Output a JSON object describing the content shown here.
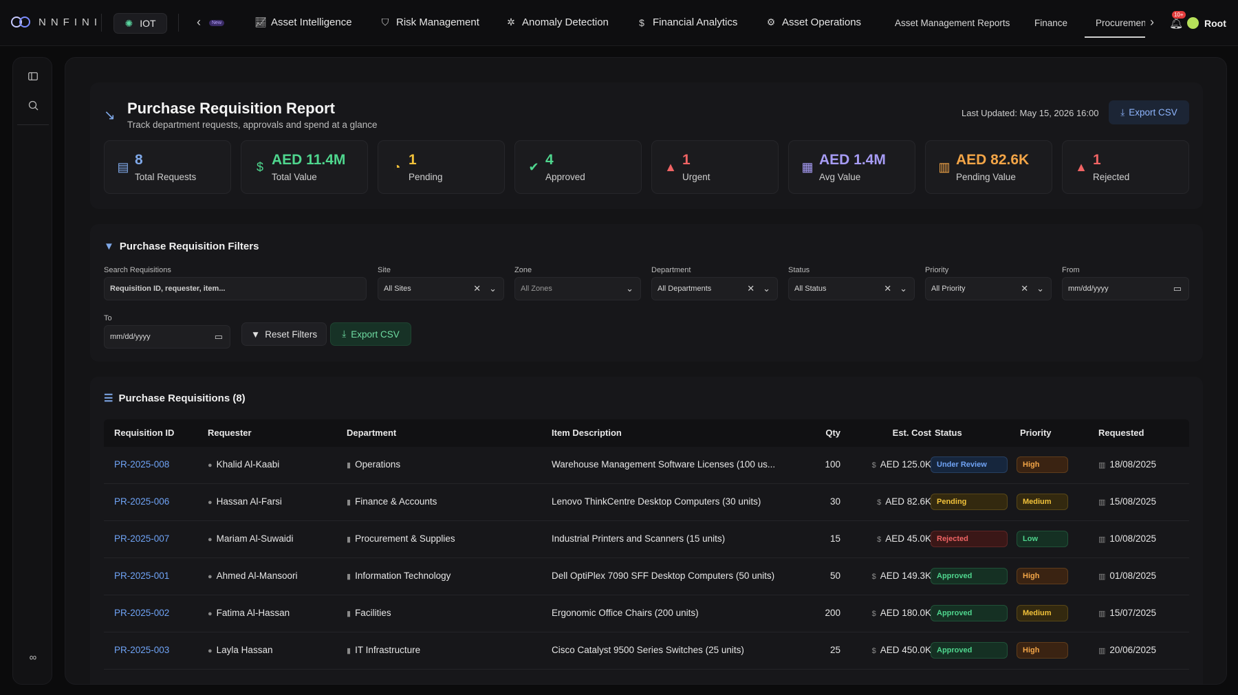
{
  "app": {
    "logo_text": "NNFINI",
    "user": "Root",
    "bell_badge": "10+"
  },
  "topnav": {
    "iot_label": "IOT",
    "new_badge": "New",
    "items": [
      {
        "label": "Asset Intelligence",
        "icon": "chart-line-icon"
      },
      {
        "label": "Risk Management",
        "icon": "shield-icon"
      },
      {
        "label": "Anomaly Detection",
        "icon": "bug-icon"
      },
      {
        "label": "Financial Analytics",
        "icon": "dollar-icon"
      },
      {
        "label": "Asset Operations",
        "icon": "gear-icon"
      }
    ],
    "tabs": [
      "Asset Management Reports",
      "Finance",
      "Procurement"
    ]
  },
  "header": {
    "title": "Purchase Requisition Report",
    "subtitle": "Track department requests, approvals and spend at a glance",
    "last_updated": "Last Updated: May 15, 2026 16:00",
    "export_label": "Export CSV"
  },
  "stats": [
    {
      "value": "8",
      "label": "Total Requests",
      "color": "#7fa8e8",
      "icon": "document-icon"
    },
    {
      "value": "AED 11.4M",
      "label": "Total Value",
      "color": "#4fd68e",
      "icon": "dollar-icon"
    },
    {
      "value": "1",
      "label": "Pending",
      "color": "#f2c23a",
      "icon": "clock-icon"
    },
    {
      "value": "4",
      "label": "Approved",
      "color": "#4fd68e",
      "icon": "check-circle-icon"
    },
    {
      "value": "1",
      "label": "Urgent",
      "color": "#f06464",
      "icon": "warning-icon"
    },
    {
      "value": "AED 1.4M",
      "label": "Avg Value",
      "color": "#a79cf5",
      "icon": "calculator-icon"
    },
    {
      "value": "AED 82.6K",
      "label": "Pending Value",
      "color": "#f3a547",
      "icon": "calendar-icon"
    },
    {
      "value": "1",
      "label": "Rejected",
      "color": "#f06464",
      "icon": "warning-icon"
    }
  ],
  "filters": {
    "title": "Purchase Requisition Filters",
    "search_label": "Search Requisitions",
    "search_placeholder": "Requisition ID, requester, item...",
    "site_label": "Site",
    "site_value": "All Sites",
    "zone_label": "Zone",
    "zone_value": "All Zones",
    "dept_label": "Department",
    "dept_value": "All Departments",
    "status_label": "Status",
    "status_value": "All Status",
    "priority_label": "Priority",
    "priority_value": "All Priority",
    "from_label": "From",
    "from_value": "mm/dd/yyyy",
    "to_label": "To",
    "to_value": "mm/dd/yyyy",
    "reset_label": "Reset Filters",
    "export_label": "Export CSV"
  },
  "table": {
    "title": "Purchase Requisitions (8)",
    "columns": [
      "Requisition ID",
      "Requester",
      "Department",
      "Item Description",
      "Qty",
      "Est. Cost",
      "Status",
      "Priority",
      "Requested"
    ],
    "rows": [
      {
        "id": "PR-2025-008",
        "requester": "Khalid Al-Kaabi",
        "dept": "Operations",
        "item": "Warehouse Management Software Licenses (100 us...",
        "qty": "100",
        "cost": "AED 125.0K",
        "status": "Under Review",
        "priority": "High",
        "date": "18/08/2025"
      },
      {
        "id": "PR-2025-006",
        "requester": "Hassan Al-Farsi",
        "dept": "Finance & Accounts",
        "item": "Lenovo ThinkCentre Desktop Computers (30 units)",
        "qty": "30",
        "cost": "AED 82.6K",
        "status": "Pending",
        "priority": "Medium",
        "date": "15/08/2025"
      },
      {
        "id": "PR-2025-007",
        "requester": "Mariam Al-Suwaidi",
        "dept": "Procurement & Supplies",
        "item": "Industrial Printers and Scanners (15 units)",
        "qty": "15",
        "cost": "AED 45.0K",
        "status": "Rejected",
        "priority": "Low",
        "date": "10/08/2025"
      },
      {
        "id": "PR-2025-001",
        "requester": "Ahmed Al-Mansoori",
        "dept": "Information Technology",
        "item": "Dell OptiPlex 7090 SFF Desktop Computers (50 units)",
        "qty": "50",
        "cost": "AED 149.3K",
        "status": "Approved",
        "priority": "High",
        "date": "01/08/2025"
      },
      {
        "id": "PR-2025-002",
        "requester": "Fatima Al-Hassan",
        "dept": "Facilities",
        "item": "Ergonomic Office Chairs (200 units)",
        "qty": "200",
        "cost": "AED 180.0K",
        "status": "Approved",
        "priority": "Medium",
        "date": "15/07/2025"
      },
      {
        "id": "PR-2025-003",
        "requester": "Layla Hassan",
        "dept": "IT Infrastructure",
        "item": "Cisco Catalyst 9500 Series Switches (25 units)",
        "qty": "25",
        "cost": "AED 450.0K",
        "status": "Approved",
        "priority": "High",
        "date": "20/06/2025"
      }
    ]
  },
  "status_colors": {
    "Under Review": {
      "bg": "#16263d",
      "fg": "#6fa3f5"
    },
    "Pending": {
      "bg": "#33290f",
      "fg": "#f2c23a"
    },
    "Rejected": {
      "bg": "#3a1717",
      "fg": "#f06464"
    },
    "Approved": {
      "bg": "#153023",
      "fg": "#4fd68e"
    }
  },
  "priority_colors": {
    "High": {
      "bg": "#3a2312",
      "fg": "#f3a547"
    },
    "Medium": {
      "bg": "#33290f",
      "fg": "#f2c23a"
    },
    "Low": {
      "bg": "#153023",
      "fg": "#4fd68e"
    }
  }
}
